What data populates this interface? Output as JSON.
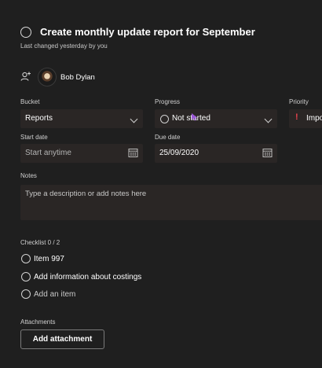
{
  "task": {
    "title": "Create monthly update report for September",
    "last_changed": "Last changed yesterday by you"
  },
  "assignee": {
    "name": "Bob Dylan",
    "assign_icon": "person-add-icon",
    "avatar_icon": "avatar"
  },
  "fields": {
    "bucket_label": "Bucket",
    "bucket_value": "Reports",
    "progress_label": "Progress",
    "progress_value": "Not started",
    "priority_label": "Priority",
    "priority_value": "Important",
    "start_date_label": "Start date",
    "start_date_placeholder": "Start anytime",
    "due_date_label": "Due date",
    "due_date_value": "25/09/2020"
  },
  "notes": {
    "label": "Notes",
    "placeholder": "Type a description or add notes here"
  },
  "checklist": {
    "label": "Checklist 0 / 2",
    "items": [
      {
        "text": "Item 997"
      },
      {
        "text": "Add information about costings"
      }
    ],
    "add_placeholder": "Add an item"
  },
  "attachments": {
    "label": "Attachments",
    "button_label": "Add attachment"
  },
  "colors": {
    "background": "#1f1f1f",
    "field_background": "#2a2625",
    "priority_important": "#e8424d",
    "cursor": "#9b59d6"
  }
}
